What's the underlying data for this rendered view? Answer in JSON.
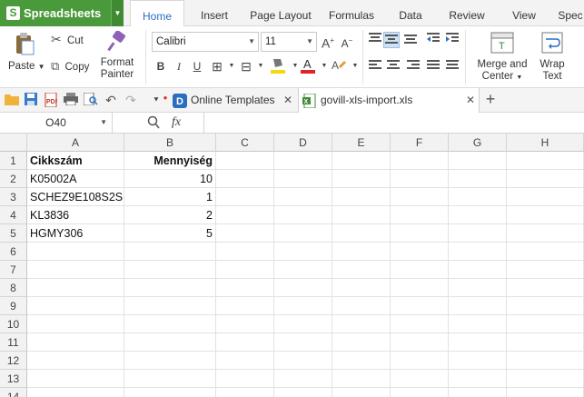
{
  "app": {
    "name": "Spreadsheets",
    "logo_letter": "S"
  },
  "menu_tabs": [
    "Home",
    "Insert",
    "Page Layout",
    "Formulas",
    "Data",
    "Review",
    "View",
    "Spec"
  ],
  "ribbon": {
    "paste_label": "Paste",
    "cut_label": "Cut",
    "copy_label": "Copy",
    "format_painter_label": "Format Painter",
    "font_name": "Calibri",
    "font_size": "11",
    "merge_center_label": "Merge and Center",
    "wrap_text_label": "Wrap Text"
  },
  "doc_tabs": [
    {
      "label": "Online Templates"
    },
    {
      "label": "govill-xls-import.xls"
    }
  ],
  "formula_bar": {
    "cell_ref": "O40",
    "fx_label": "fx",
    "formula": ""
  },
  "columns": [
    "A",
    "B",
    "C",
    "D",
    "E",
    "F",
    "G",
    "H"
  ],
  "rows": [
    "1",
    "2",
    "3",
    "4",
    "5",
    "6",
    "7",
    "8",
    "9",
    "10",
    "11",
    "12",
    "13",
    "14"
  ],
  "sheet": [
    [
      "Cikkszám",
      "Mennyiség"
    ],
    [
      "K05002A",
      "10"
    ],
    [
      "SCHEZ9E108S2S",
      "1"
    ],
    [
      "KL3836",
      "2"
    ],
    [
      "HGMY306",
      "5"
    ]
  ],
  "colors": {
    "accent": "#4a9a3c",
    "tab_active": "#2a6fbf"
  }
}
